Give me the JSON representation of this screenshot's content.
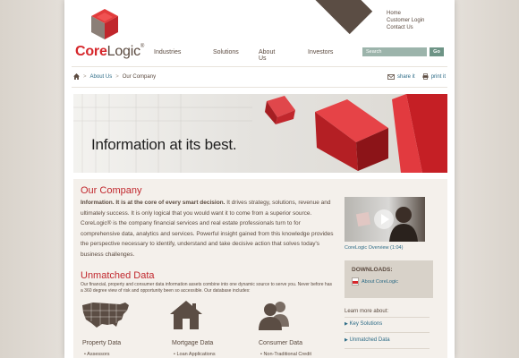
{
  "brand": {
    "core": "Core",
    "logic": "Logic",
    "reg": "®"
  },
  "utility_links": [
    "Home",
    "Customer Login",
    "Contact Us"
  ],
  "nav": {
    "industries": "Industries",
    "solutions": "Solutions",
    "about": "About Us",
    "investors": "Investors"
  },
  "search": {
    "placeholder": "Search",
    "button": "Go"
  },
  "breadcrumb": {
    "about": "About Us",
    "sep": ">",
    "current": "Our Company"
  },
  "tools": {
    "share": "share it",
    "print": "print it"
  },
  "hero": {
    "tagline": "Information at its best."
  },
  "our_company": {
    "title": "Our Company",
    "lead": "Information. It is at the core of every smart decision.",
    "body": " It drives strategy, solutions, revenue and ultimately success. It is only logical that you would want it to come from a superior source. CoreLogic® is the company financial services and real estate professionals turn to for comprehensive data, analytics and services. Powerful insight gained from this knowledge provides the perspective necessary to identify, understand and take decisive action that solves today's business challenges."
  },
  "unmatched": {
    "title": "Unmatched Data",
    "body": "Our financial, property and consumer data information assets combine into one dynamic source to serve you. Never before has a 360 degree view of risk and opportunity been so accessible. Our database includes:"
  },
  "categories": [
    {
      "label": "Property Data",
      "bullet": "• Assessors"
    },
    {
      "label": "Mortgage Data",
      "bullet": "• Loan Applications"
    },
    {
      "label": "Consumer Data",
      "bullet": "• Non-Traditional Credit"
    }
  ],
  "video": {
    "caption": "CoreLogic Overview (1:04)"
  },
  "downloads": {
    "title": "DOWNLOADS:",
    "item": "About CoreLogic"
  },
  "learn_more": {
    "title": "Learn more about:",
    "items": [
      "Key Solutions",
      "Unmatched Data"
    ]
  },
  "colors": {
    "brand_red": "#d6272b",
    "link_blue": "#2c6b86",
    "search_green": "#9cb4ab",
    "go_green": "#6e9486",
    "text_brown": "#5b4a3f"
  },
  "icons": [
    "home-icon",
    "envelope-icon",
    "printer-icon",
    "play-icon",
    "pdf-icon",
    "us-map-icon",
    "house-icon",
    "people-icon",
    "arrow-right-icon"
  ]
}
